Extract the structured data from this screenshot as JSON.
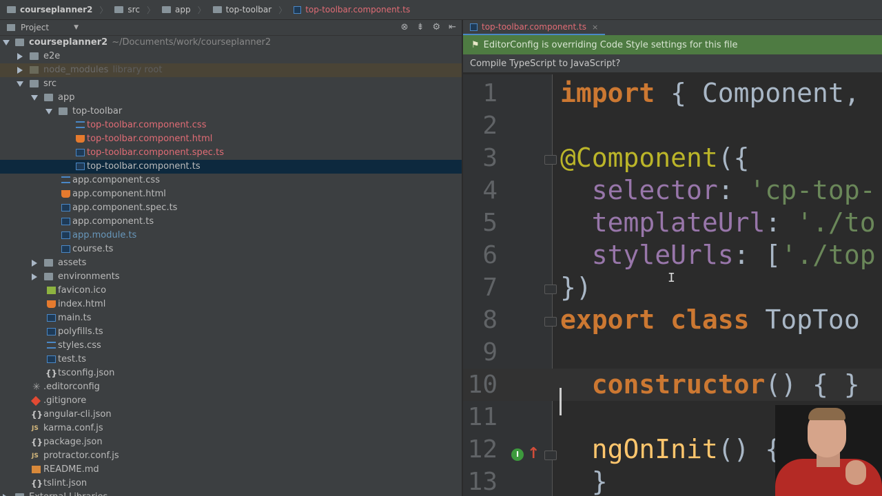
{
  "breadcrumb": {
    "items": [
      "courseplanner2",
      "src",
      "app",
      "top-toolbar",
      "top-toolbar.component.ts"
    ]
  },
  "project_panel": {
    "title": "Project",
    "tree": [
      {
        "label": "courseplanner2",
        "hint": "~/Documents/work/courseplanner2"
      },
      {
        "label": "e2e"
      },
      {
        "label": "node_modules",
        "hint": "library root"
      },
      {
        "label": "src"
      },
      {
        "label": "app"
      },
      {
        "label": "top-toolbar"
      },
      {
        "label": "top-toolbar.component.css"
      },
      {
        "label": "top-toolbar.component.html"
      },
      {
        "label": "top-toolbar.component.spec.ts"
      },
      {
        "label": "top-toolbar.component.ts"
      },
      {
        "label": "app.component.css"
      },
      {
        "label": "app.component.html"
      },
      {
        "label": "app.component.spec.ts"
      },
      {
        "label": "app.component.ts"
      },
      {
        "label": "app.module.ts"
      },
      {
        "label": "course.ts"
      },
      {
        "label": "assets"
      },
      {
        "label": "environments"
      },
      {
        "label": "favicon.ico"
      },
      {
        "label": "index.html"
      },
      {
        "label": "main.ts"
      },
      {
        "label": "polyfills.ts"
      },
      {
        "label": "styles.css"
      },
      {
        "label": "test.ts"
      },
      {
        "label": "tsconfig.json"
      },
      {
        "label": ".editorconfig"
      },
      {
        "label": ".gitignore"
      },
      {
        "label": "angular-cli.json"
      },
      {
        "label": "karma.conf.js"
      },
      {
        "label": "package.json"
      },
      {
        "label": "protractor.conf.js"
      },
      {
        "label": "README.md"
      },
      {
        "label": "tslint.json"
      },
      {
        "label": "External Libraries"
      }
    ]
  },
  "editor": {
    "tab_label": "top-toolbar.component.ts",
    "tab_close": "×",
    "notice": "EditorConfig is overriding Code Style settings for this file",
    "compile_prompt": "Compile TypeScript to JavaScript?",
    "impl_icon": "I",
    "lines": [
      {
        "num": "1",
        "tokens": [
          {
            "t": "import",
            "c": "kw"
          },
          {
            "t": " { Component,",
            "c": "plain"
          }
        ]
      },
      {
        "num": "2",
        "tokens": []
      },
      {
        "num": "3",
        "tokens": [
          {
            "t": "@Component",
            "c": "dec"
          },
          {
            "t": "({",
            "c": "plain"
          }
        ]
      },
      {
        "num": "4",
        "tokens": [
          {
            "t": "  selector",
            "c": "prop"
          },
          {
            "t": ": ",
            "c": "plain"
          },
          {
            "t": "'cp-top-",
            "c": "str"
          }
        ]
      },
      {
        "num": "5",
        "tokens": [
          {
            "t": "  templateUrl",
            "c": "prop"
          },
          {
            "t": ": ",
            "c": "plain"
          },
          {
            "t": "'./to",
            "c": "str"
          }
        ]
      },
      {
        "num": "6",
        "tokens": [
          {
            "t": "  styleUrls",
            "c": "prop"
          },
          {
            "t": ": [",
            "c": "plain"
          },
          {
            "t": "'./top",
            "c": "str"
          }
        ]
      },
      {
        "num": "7",
        "tokens": [
          {
            "t": "})",
            "c": "plain"
          }
        ]
      },
      {
        "num": "8",
        "tokens": [
          {
            "t": "export class",
            "c": "kw"
          },
          {
            "t": " TopToo",
            "c": "plain"
          }
        ]
      },
      {
        "num": "9",
        "tokens": []
      },
      {
        "num": "10",
        "tokens": [
          {
            "t": "  constructor",
            "c": "kw"
          },
          {
            "t": "() { }",
            "c": "plain"
          }
        ]
      },
      {
        "num": "11",
        "tokens": []
      },
      {
        "num": "12",
        "tokens": [
          {
            "t": "  ngOnInit",
            "c": "fn"
          },
          {
            "t": "() {",
            "c": "plain"
          }
        ]
      },
      {
        "num": "13",
        "tokens": [
          {
            "t": "  }",
            "c": "plain"
          }
        ]
      }
    ]
  }
}
